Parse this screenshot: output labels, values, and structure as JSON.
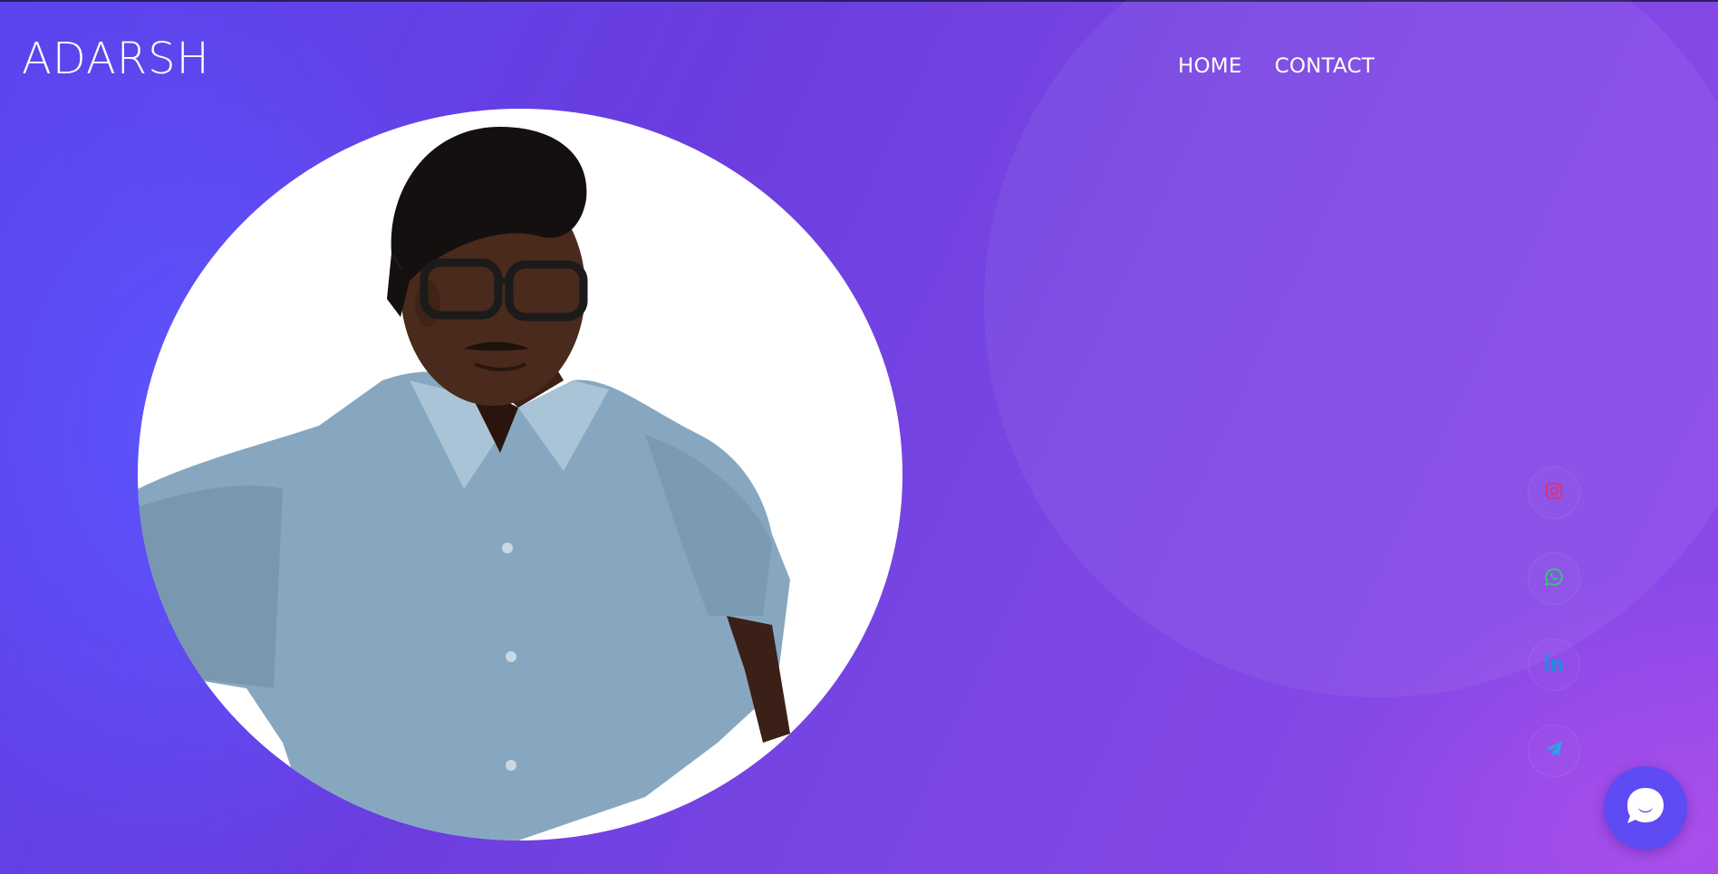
{
  "site": {
    "logo_text": "ADARSH"
  },
  "nav": {
    "items": [
      {
        "label": "HOME"
      },
      {
        "label": "CONTACT"
      }
    ]
  },
  "hero": {
    "photo_icon": "profile-photo"
  },
  "social_links": [
    {
      "icon": "instagram-icon",
      "color": "#e1306c"
    },
    {
      "icon": "whatsapp-icon",
      "color": "#25d366"
    },
    {
      "icon": "linkedin-icon",
      "color": "#1e8fdc"
    },
    {
      "icon": "telegram-icon",
      "color": "#2aa3e8"
    }
  ],
  "chat_widget": {
    "icon": "chat-bubble-icon",
    "color": "#5e4bf4"
  },
  "colors": {
    "background_start": "#5a45ee",
    "background_end": "#8f49ea",
    "text": "#ffffff"
  }
}
